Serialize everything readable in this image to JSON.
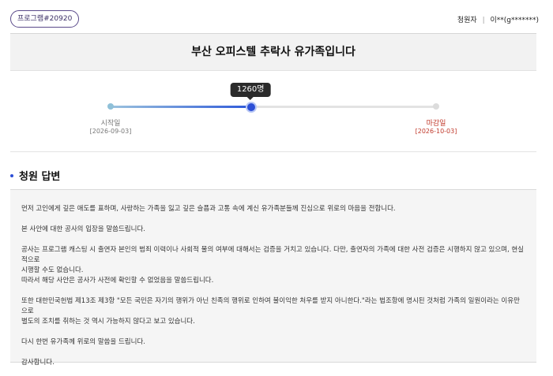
{
  "header": {
    "badge": "프로그램#20920",
    "petitioner_label": "청원자",
    "petitioner_sep": "|",
    "petitioner_name": "이**(g*******)"
  },
  "petition": {
    "title": "부산 오피스텔 추락사 유가족입니다"
  },
  "progress": {
    "count": "1260명",
    "fraction": 0.43,
    "start_label": "시작일",
    "start_date": "[2026-09-03]",
    "end_label": "마감일",
    "end_date": "[2026-10-03]"
  },
  "answer": {
    "title": "청원 답변",
    "paragraphs": [
      [
        "먼저 고인에게 깊은 애도를 표하며, 사랑하는 가족을 잃고 깊은 슬픔과 고통 속에 계신 유가족분들께 진심으로 위로의 마음을 전합니다."
      ],
      [
        "본 사안에 대한 공사의 입장을 말씀드립니다."
      ],
      [
        "공사는 프로그램 캐스팅 시 출연자 본인의 범죄 이력이나 사회적 물의 여부에 대해서는 검증을 거치고 있습니다. 다만, 출연자의 가족에 대한 사전 검증은 시행하지 않고 있으며, 현실적으로",
        "시행할 수도 없습니다.",
        "따라서 해당 사안은 공사가 사전에 확인할 수 없었음을 말씀드립니다."
      ],
      [
        "또한 대한민국헌법 제13조 제3항 \"모든 국민은 자기의 행위가 아닌 친족의 행위로 인하여 불이익한 처우를 받지 아니한다.\"라는 법조항에 명시된 것처럼 가족의 일원이라는 이유만으로",
        "별도의 조치를 취하는 것 역시 가능하지 않다고 보고 있습니다."
      ],
      [
        "다시 한번 유가족께 위로의 말씀을 드립니다."
      ],
      [
        "감사합니다."
      ]
    ]
  },
  "colors": {
    "accent": "#2d4fd6",
    "deadline": "#c0392b",
    "badge_border": "#5a4a8a"
  }
}
